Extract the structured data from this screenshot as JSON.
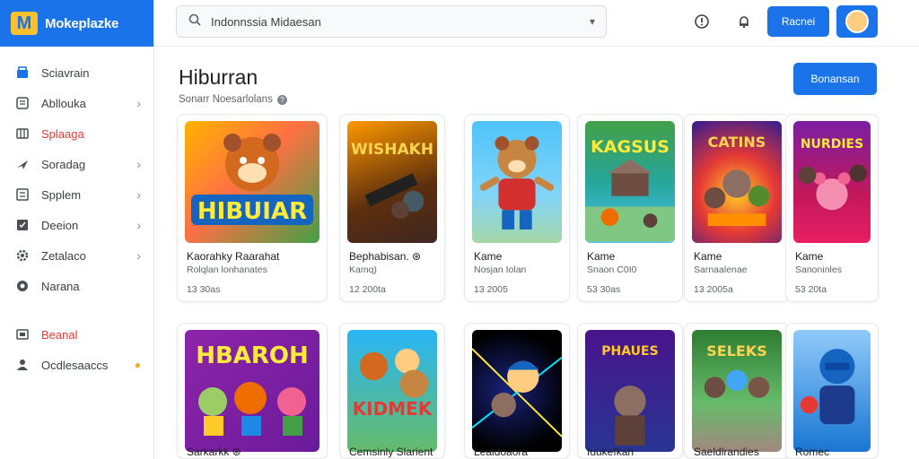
{
  "brand": {
    "name": "Mokeplazke"
  },
  "sidebar": {
    "items": [
      {
        "label": "Sciavrain",
        "icon": "store-icon",
        "chevron": false,
        "active": false
      },
      {
        "label": "Abllouka",
        "icon": "apps-icon",
        "chevron": true,
        "active": false
      },
      {
        "label": "Splaaga",
        "icon": "grid-icon",
        "chevron": false,
        "active": true
      },
      {
        "label": "Soradag",
        "icon": "send-icon",
        "chevron": true,
        "active": false
      },
      {
        "label": "Spplem",
        "icon": "list-icon",
        "chevron": true,
        "active": false
      },
      {
        "label": "Deeion",
        "icon": "checkbox-icon",
        "chevron": true,
        "active": false
      },
      {
        "label": "Zetalaco",
        "icon": "gear-icon",
        "chevron": true,
        "active": false
      },
      {
        "label": "Narana",
        "icon": "globe-icon",
        "chevron": false,
        "active": false
      }
    ],
    "bottom_items": [
      {
        "label": "Beanal",
        "icon": "mail-icon",
        "active": true
      },
      {
        "label": "Ocdlesaaccs",
        "icon": "people-icon",
        "badge": "●"
      }
    ]
  },
  "search": {
    "value": "Indonnssia Midaesan",
    "mic": "▾"
  },
  "topbar": {
    "button_label": "Racnei"
  },
  "main": {
    "title": "Hiburran",
    "subtitle": "Sonarr Noesarlolans",
    "button_label": "Bonansan"
  },
  "cards_row1": [
    {
      "title": "Kaorahky Raarahat",
      "sub": "Rolqlan lonhanates",
      "meta": "13 30as",
      "theme": "hibuar",
      "thumb_text": "HIBUIAR"
    },
    {
      "title": "Bephabisan. ⊛",
      "sub": "Kamq)",
      "meta": "12 200ta",
      "theme": "wishakh",
      "thumb_text": "WISHAKH"
    },
    {
      "title": "Kame",
      "sub": "Nosjan Iolan",
      "meta": "13 2005",
      "theme": "bear",
      "thumb_text": ""
    },
    {
      "title": "Kame",
      "sub": "Snaon  C0I0",
      "meta": "53 30as",
      "theme": "kagsus",
      "thumb_text": "KAGSUS"
    },
    {
      "title": "Kame",
      "sub": "Sarnaalenae",
      "meta": "13 2005a",
      "theme": "catins",
      "thumb_text": "CATINS"
    },
    {
      "title": "Kame",
      "sub": "Sanoninles",
      "meta": "53 20ta",
      "theme": "nurdies",
      "thumb_text": "NURDIES"
    }
  ],
  "cards_row2": [
    {
      "title": "Sarkarkk ⊛",
      "theme": "hbaroh",
      "thumb_text": "HBAROH"
    },
    {
      "title": "Cemsinly Slarient",
      "theme": "kidmek",
      "thumb_text": "KIDMEK"
    },
    {
      "title": "Lealdoaora",
      "theme": "boy",
      "thumb_text": ""
    },
    {
      "title": "Iuukefkah",
      "theme": "phaues",
      "thumb_text": "PHAUES"
    },
    {
      "title": "Saeldlrandies",
      "theme": "seleks",
      "thumb_text": "SELEKS"
    },
    {
      "title": "Romec",
      "theme": "ninja",
      "thumb_text": ""
    }
  ],
  "colors": {
    "accent": "#1a73e8",
    "active": "#e53935",
    "brand_logo": "#fbc02d"
  }
}
